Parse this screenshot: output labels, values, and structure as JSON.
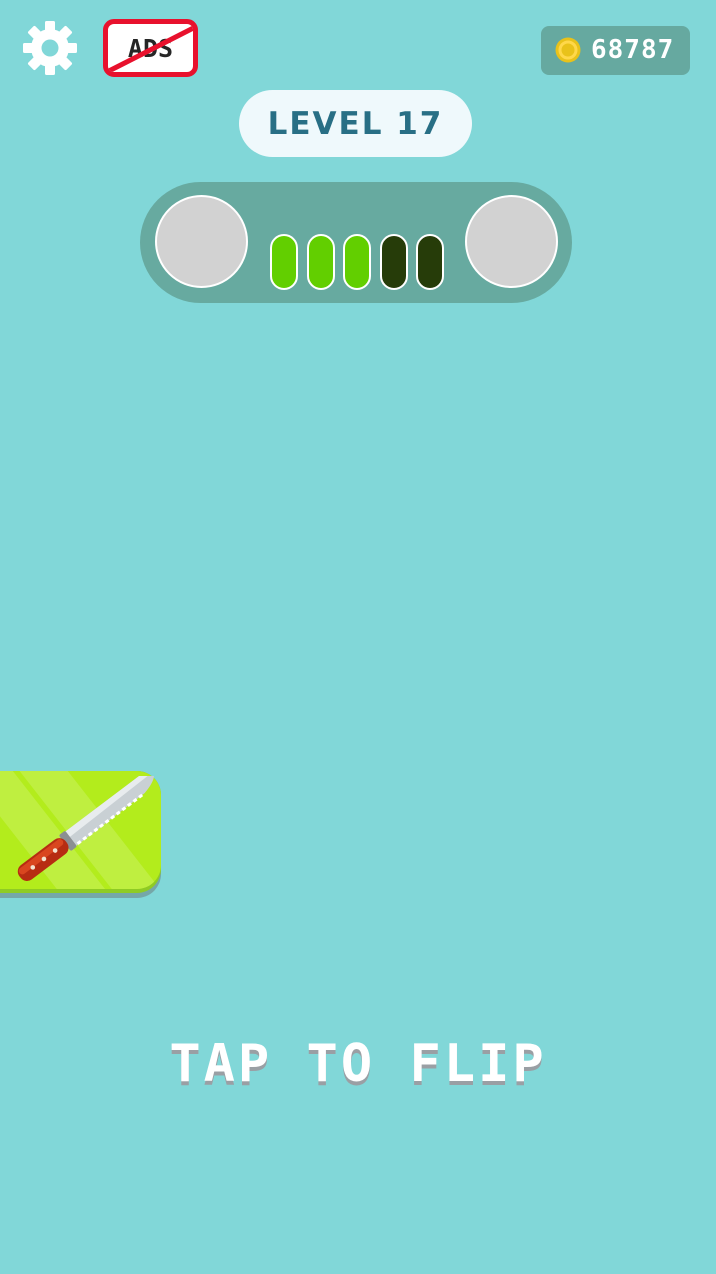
{
  "hud": {
    "settings_icon": "gear-icon",
    "no_ads_label": "ADS",
    "coins": "68787",
    "coin_icon": "coin-icon"
  },
  "level": {
    "label": "LEVEL 17"
  },
  "progress": {
    "stages_completed": 3,
    "stages_total": 5
  },
  "game": {
    "prompt": "TAP TO FLIP"
  },
  "colors": {
    "background": "#81d7d8",
    "accent_red": "#e8112d",
    "progress_done": "#62cf00",
    "progress_todo": "#263c09",
    "level_text": "#286f85"
  }
}
